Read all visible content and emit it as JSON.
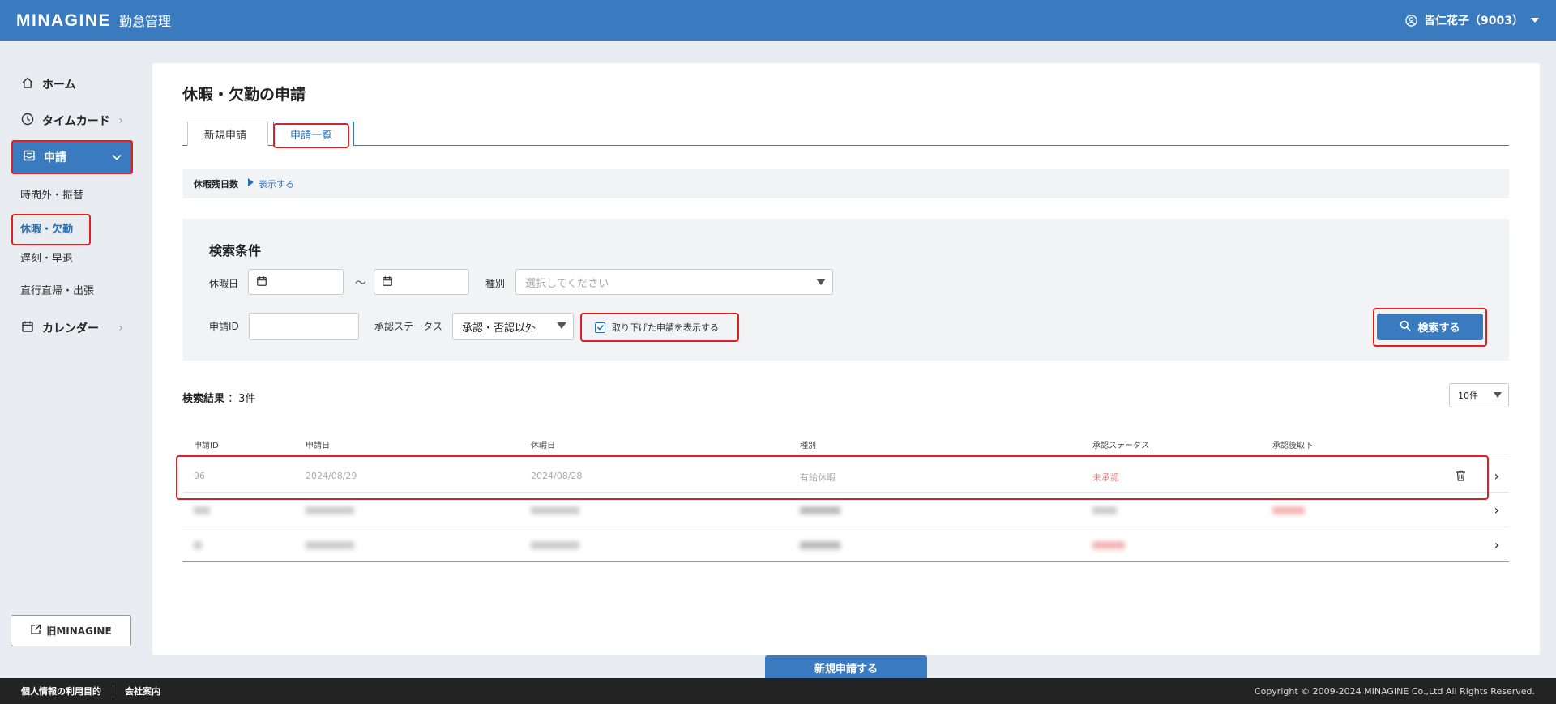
{
  "header": {
    "logo": "MINAGINE",
    "app_name": "勤怠管理",
    "user": "皆仁花子（9003）"
  },
  "sidebar": {
    "items": [
      {
        "label": "ホーム"
      },
      {
        "label": "タイムカード"
      },
      {
        "label": "申請"
      },
      {
        "label": "カレンダー"
      }
    ],
    "sub_items": [
      {
        "label": "時間外・振替"
      },
      {
        "label": "休暇・欠勤"
      },
      {
        "label": "遅刻・早退"
      },
      {
        "label": "直行直帰・出張"
      }
    ],
    "old_link": "旧MINAGINE"
  },
  "page": {
    "title": "休暇・欠勤の申請",
    "tabs": [
      {
        "label": "新規申請"
      },
      {
        "label": "申請一覧"
      }
    ],
    "remain": {
      "label": "休暇残日数",
      "toggle": "表示する"
    }
  },
  "search": {
    "title": "検索条件",
    "date_label": "休暇日",
    "tilde": "～",
    "type_label": "種別",
    "type_placeholder": "選択してください",
    "id_label": "申請ID",
    "status_label": "承認ステータス",
    "status_value": "承認・否認以外",
    "withdrawn_label": "取り下げた申請を表示する",
    "button": "検索する"
  },
  "results": {
    "label": "検索結果",
    "count": "：3件",
    "per_page": "10件",
    "columns": [
      "申請ID",
      "申請日",
      "休暇日",
      "種別",
      "承認ステータス",
      "承認後取下"
    ],
    "rows": [
      {
        "id": "96",
        "applied": "2024/08/29",
        "vacation": "2024/08/28",
        "type": "有給休暇",
        "status": "未承認",
        "withdraw": ""
      }
    ]
  },
  "new_button": "新規申請する",
  "footer": {
    "privacy": "個人情報の利用目的",
    "company": "会社案内",
    "copyright": "Copyright © 2009-2024 MINAGINE Co.,Ltd All Rights Reserved."
  },
  "colors": {
    "primary": "#3a7bbf",
    "highlight": "#e02020",
    "footer": "#232323"
  }
}
